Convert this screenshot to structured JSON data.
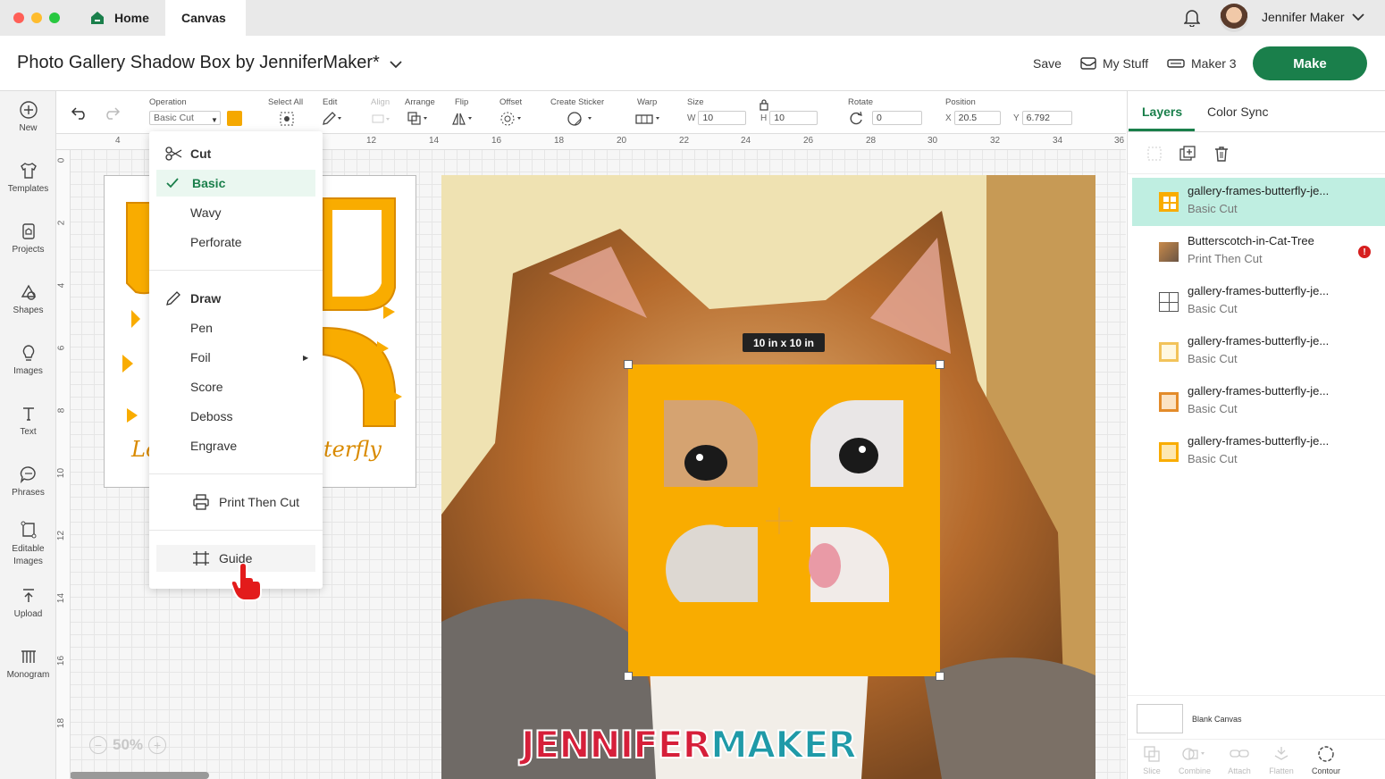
{
  "window": {
    "tabs": [
      {
        "label": "Home"
      },
      {
        "label": "Canvas"
      }
    ],
    "user_name": "Jennifer Maker"
  },
  "header": {
    "project_title": "Photo Gallery Shadow Box by JenniferMaker*",
    "save_label": "Save",
    "my_stuff_label": "My Stuff",
    "machine_label": "Maker 3",
    "make_label": "Make"
  },
  "sidebar": {
    "items": [
      {
        "label": "New",
        "icon": "plus-circle-icon"
      },
      {
        "label": "Templates",
        "icon": "shirt-icon"
      },
      {
        "label": "Projects",
        "icon": "projects-icon"
      },
      {
        "label": "Shapes",
        "icon": "shapes-icon"
      },
      {
        "label": "Images",
        "icon": "lightbulb-icon"
      },
      {
        "label": "Text",
        "icon": "text-icon"
      },
      {
        "label": "Phrases",
        "icon": "speech-bubble-icon"
      },
      {
        "label": "Editable Images",
        "icon": "editable-images-icon"
      },
      {
        "label": "Upload",
        "icon": "upload-icon"
      },
      {
        "label": "Monogram",
        "icon": "monogram-icon"
      }
    ]
  },
  "toolbar": {
    "operation_label": "Operation",
    "operation_value": "Basic Cut",
    "operation_color": "#f5a800",
    "select_all_label": "Select All",
    "edit_label": "Edit",
    "align_label": "Align",
    "arrange_label": "Arrange",
    "flip_label": "Flip",
    "offset_label": "Offset",
    "create_sticker_label": "Create Sticker",
    "warp_label": "Warp",
    "size_label": "Size",
    "w_label": "W",
    "w_value": "10",
    "h_label": "H",
    "h_value": "10",
    "rotate_label": "Rotate",
    "rotate_value": "0",
    "position_label": "Position",
    "x_label": "X",
    "x_value": "20.5",
    "y_label": "Y",
    "y_value": "6.792"
  },
  "ruler": {
    "top_ticks": [
      "4",
      "12",
      "14",
      "16",
      "18",
      "20",
      "22",
      "24",
      "26",
      "28",
      "30",
      "32",
      "34",
      "36"
    ],
    "left_ticks": [
      "0",
      "2",
      "4",
      "6",
      "8",
      "10",
      "12",
      "14",
      "16",
      "18"
    ]
  },
  "operation_menu": {
    "cut_header": "Cut",
    "cut_items": [
      "Basic",
      "Wavy",
      "Perforate"
    ],
    "draw_header": "Draw",
    "draw_items": [
      "Pen",
      "Foil",
      "Score",
      "Deboss",
      "Engrave"
    ],
    "print_then_cut": "Print Then Cut",
    "guide": "Guide"
  },
  "canvas": {
    "size_tooltip": "10  in x 10  in",
    "zoom": "50%",
    "watermark_part1": "JENNIFER",
    "watermark_part2": "MAKER",
    "card_text_left": "Lo",
    "card_text_right": "terfly"
  },
  "right_panel": {
    "tabs": [
      {
        "label": "Layers"
      },
      {
        "label": "Color Sync"
      }
    ],
    "layers": [
      {
        "name": "gallery-frames-butterfly-je...",
        "type": "Basic Cut"
      },
      {
        "name": "Butterscotch-in-Cat-Tree",
        "type": "Print Then Cut"
      },
      {
        "name": "gallery-frames-butterfly-je...",
        "type": "Basic Cut"
      },
      {
        "name": "gallery-frames-butterfly-je...",
        "type": "Basic Cut"
      },
      {
        "name": "gallery-frames-butterfly-je...",
        "type": "Basic Cut"
      },
      {
        "name": "gallery-frames-butterfly-je...",
        "type": "Basic Cut"
      }
    ],
    "blank_canvas_label": "Blank Canvas",
    "bottom_tools": [
      "Slice",
      "Combine",
      "Attach",
      "Flatten",
      "Contour"
    ]
  },
  "colors": {
    "accent_green": "#1a7f4b",
    "selected_layer": "#bfeee1",
    "frame_yellow": "#f9ac00",
    "alert_red": "#d61f1f"
  }
}
